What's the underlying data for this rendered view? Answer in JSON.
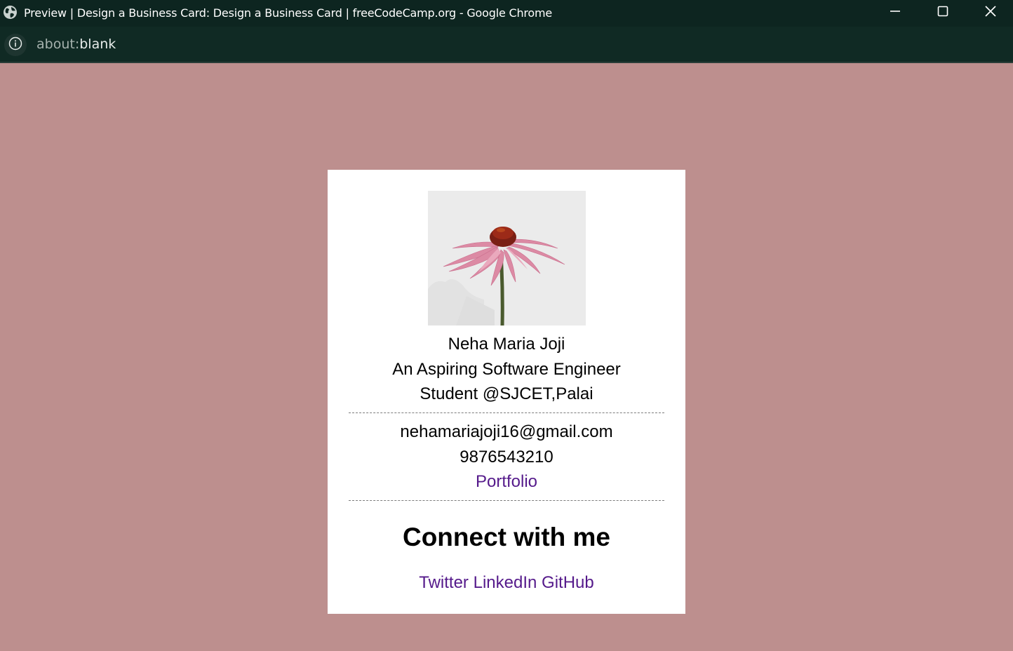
{
  "window": {
    "title": "Preview | Design a Business Card: Design a Business Card | freeCodeCamp.org - Google Chrome",
    "controls": [
      "minimize",
      "maximize",
      "close"
    ]
  },
  "address_bar": {
    "scheme": "about:",
    "path": "blank",
    "icon": "info-icon"
  },
  "colors": {
    "page_background": "#bd8f8e",
    "card_background": "#ffffff",
    "link": "#551a8b",
    "titlebar": "#0d2520"
  },
  "card": {
    "photo_icon": "flower-photo",
    "name": "Neha Maria Joji",
    "label": "An Aspiring Software Engineer",
    "company": "Student @SJCET,Palai",
    "email": "nehamariajoji16@gmail.com",
    "phone": "9876543210",
    "portfolio": "Portfolio",
    "connect_heading": "Connect with me",
    "social_links": [
      "Twitter",
      "LinkedIn",
      "GitHub"
    ]
  }
}
